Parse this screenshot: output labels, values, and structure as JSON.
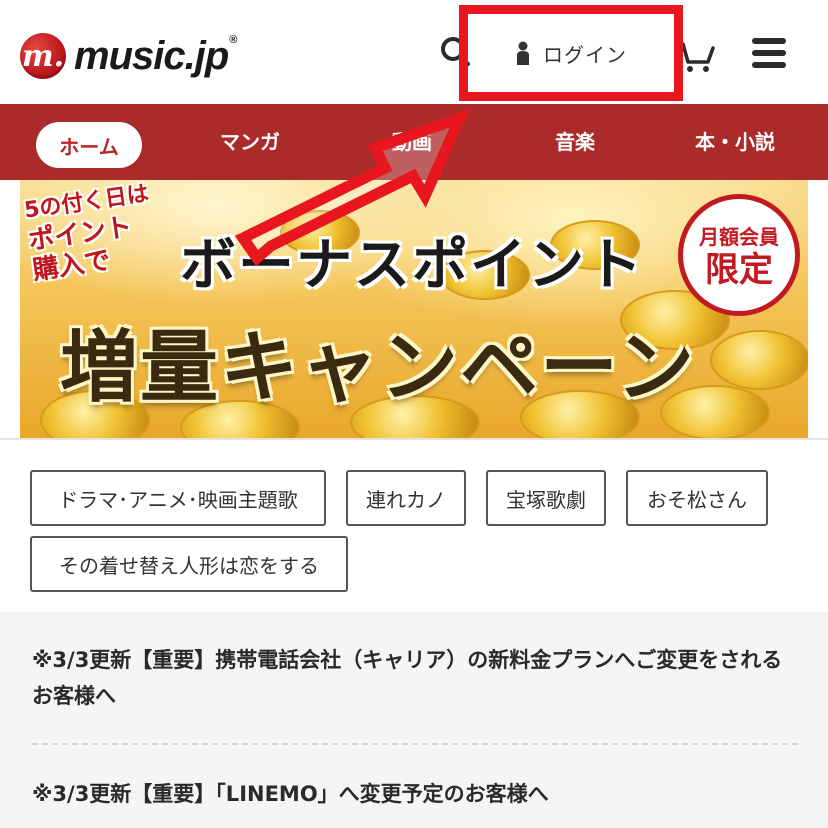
{
  "header": {
    "logo_mark": "m.",
    "logo_text": "music.jp",
    "logo_reg": "®",
    "login_label": "ログイン",
    "icons": [
      "search-icon",
      "cart-icon",
      "menu-icon",
      "person-icon"
    ]
  },
  "nav": {
    "items": [
      {
        "label": "ホーム",
        "active": true
      },
      {
        "label": "マンガ"
      },
      {
        "label": "動画"
      },
      {
        "label": "音楽"
      },
      {
        "label": "本・小説"
      }
    ]
  },
  "banner": {
    "tag_line1": "5の付く日は",
    "tag_line2": "ポイント",
    "tag_line3": "購入で",
    "title_line1": "ボーナスポイント",
    "title_line2": "増量キャンペーン",
    "badge_line1": "月額会員",
    "badge_line2": "限定"
  },
  "tags": [
    "ドラマ･アニメ･映画主題歌",
    "連れカノ",
    "宝塚歌劇",
    "おそ松さん",
    "その着せ替え人形は恋をする"
  ],
  "news": [
    "※3/3更新【重要】携帯電話会社（キャリア）の新料金プランへご変更をされるお客様へ",
    "※3/3更新【重要】「LINEMO」へ変更予定のお客様へ"
  ],
  "colors": {
    "nav_bg": "#ab2a2a",
    "highlight": "#e8161e",
    "news_bg": "#f5f5f5"
  }
}
